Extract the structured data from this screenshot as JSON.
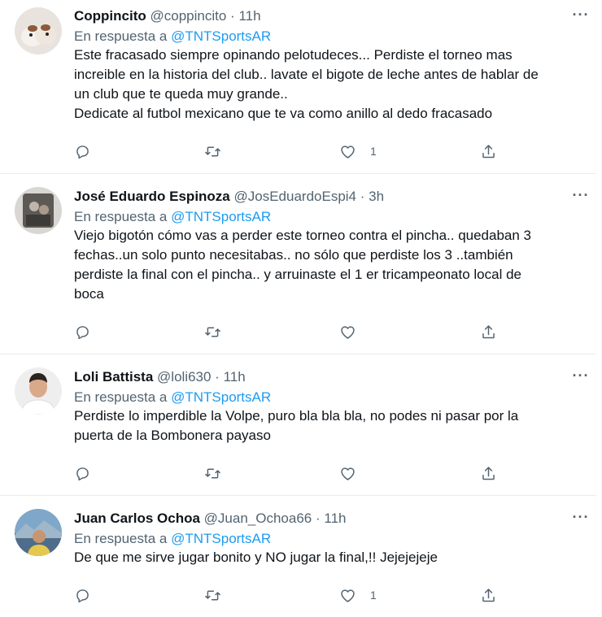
{
  "tweets": [
    {
      "name": "Coppincito",
      "handle": "@coppincito",
      "dot": "·",
      "time": "11h",
      "reply_prefix": "En respuesta a",
      "reply_to": "@TNTSportsAR",
      "text_lines": [
        "Este fracasado siempre opinando pelotudeces... Perdiste el torneo mas",
        "increible en la historia del club.. lavate el bigote de leche antes de hablar de",
        "un club que te queda muy grande..",
        "Dedicate al futbol mexicano que te va como anillo al dedo fracasado"
      ],
      "like_count": "1"
    },
    {
      "name": "José Eduardo Espinoza",
      "handle": "@JosEduardoEspi4",
      "dot": "·",
      "time": "3h",
      "reply_prefix": "En respuesta a",
      "reply_to": "@TNTSportsAR",
      "text_lines": [
        "Viejo bigotón cómo vas a perder este torneo contra el pincha.. quedaban 3",
        "fechas..un solo punto necesitabas.. no sólo que perdiste los 3 ..también",
        "perdiste la final con el pincha.. y arruinaste el 1 er tricampeonato local de",
        "boca"
      ],
      "like_count": ""
    },
    {
      "name": "Loli Battista",
      "handle": "@loli630",
      "dot": "·",
      "time": "11h",
      "reply_prefix": "En respuesta a",
      "reply_to": "@TNTSportsAR",
      "text_lines": [
        "Perdiste lo imperdible la Volpe, puro bla bla bla, no podes ni pasar por la",
        "puerta de la Bombonera payaso"
      ],
      "like_count": ""
    },
    {
      "name": "Juan Carlos Ochoa",
      "handle": "@Juan_Ochoa66",
      "dot": "·",
      "time": "11h",
      "reply_prefix": "En respuesta a",
      "reply_to": "@TNTSportsAR",
      "text_lines": [
        "De que me sirve jugar bonito y NO jugar la final,!! Jejejejeje"
      ],
      "like_count": "1"
    }
  ],
  "more_label": "···",
  "icons": {
    "reply": "reply-icon",
    "retweet": "retweet-icon",
    "like": "heart-icon",
    "share": "share-icon",
    "more": "more-icon"
  },
  "colors": {
    "text": "#0f1419",
    "muted": "#536471",
    "link": "#1d9bf0",
    "border": "#e6ecf0"
  }
}
